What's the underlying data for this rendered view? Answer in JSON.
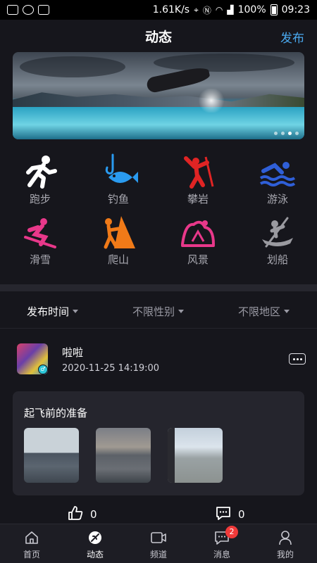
{
  "status_bar": {
    "speed": "1.61K/s",
    "battery": "100%",
    "time": "09:23"
  },
  "header": {
    "title": "动态",
    "publish": "发布"
  },
  "categories": [
    {
      "label": "跑步",
      "icon": "running-icon",
      "color": "#ffffff"
    },
    {
      "label": "钓鱼",
      "icon": "fishing-icon",
      "color": "#2a9bf0"
    },
    {
      "label": "攀岩",
      "icon": "climbing-icon",
      "color": "#e02424"
    },
    {
      "label": "游泳",
      "icon": "swimming-icon",
      "color": "#2f5fd8"
    },
    {
      "label": "滑雪",
      "icon": "skiing-icon",
      "color": "#e8388a"
    },
    {
      "label": "爬山",
      "icon": "mountaineering-icon",
      "color": "#f07a18"
    },
    {
      "label": "风景",
      "icon": "scenery-icon",
      "color": "#e8388a"
    },
    {
      "label": "划船",
      "icon": "rowing-icon",
      "color": "#9a9aa0"
    }
  ],
  "filters": [
    {
      "label": "发布时间"
    },
    {
      "label": "不限性别"
    },
    {
      "label": "不限地区"
    }
  ],
  "post": {
    "user": "啦啦",
    "time": "2020-11-25 14:19:00",
    "title": "起飞前的准备",
    "likes": "0",
    "comments": "0"
  },
  "nav": [
    {
      "label": "首页",
      "icon": "home-icon"
    },
    {
      "label": "动态",
      "icon": "feed-icon"
    },
    {
      "label": "频道",
      "icon": "channel-icon"
    },
    {
      "label": "消息",
      "icon": "message-icon",
      "badge": "2"
    },
    {
      "label": "我的",
      "icon": "profile-icon"
    }
  ],
  "colors": {
    "accent": "#4aa8ee",
    "background": "#16161c",
    "card": "#25252d",
    "badge": "#f03a3a"
  }
}
